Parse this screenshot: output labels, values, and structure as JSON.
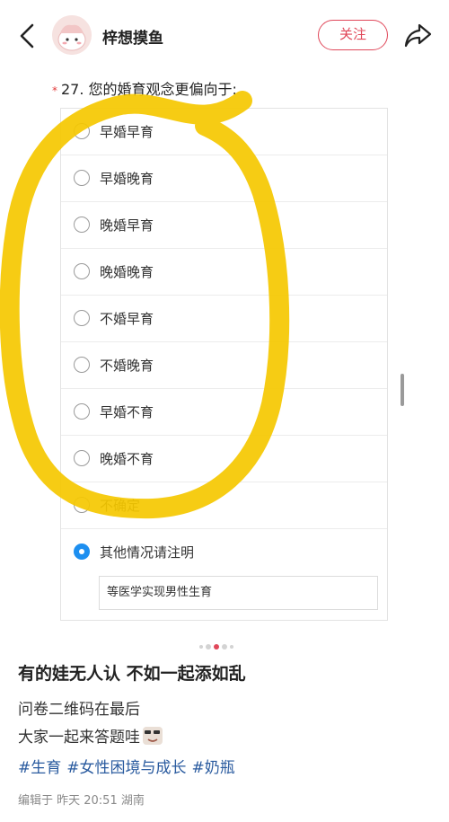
{
  "header": {
    "username": "梓想摸鱼",
    "follow_label": "关注"
  },
  "question": {
    "required_mark": "*",
    "text": "27. 您的婚育观念更偏向于:"
  },
  "options": [
    {
      "label": "早婚早育",
      "selected": false
    },
    {
      "label": "早婚晚育",
      "selected": false
    },
    {
      "label": "晚婚早育",
      "selected": false
    },
    {
      "label": "晚婚晚育",
      "selected": false
    },
    {
      "label": "不婚早育",
      "selected": false
    },
    {
      "label": "不婚晚育",
      "selected": false
    },
    {
      "label": "早婚不育",
      "selected": false
    },
    {
      "label": "晚婚不育",
      "selected": false
    },
    {
      "label": "不确定",
      "selected": false
    },
    {
      "label": "其他情况请注明",
      "selected": true
    }
  ],
  "other_input_value": "等医学实现男性生育",
  "carousel": {
    "count": 5,
    "active_index": 2
  },
  "post": {
    "title": "有的娃无人认  不如一起添如乱",
    "line1": "问卷二维码在最后",
    "line2": "大家一起来答题哇",
    "tags": [
      "#生育",
      "#女性困境与成长",
      "#奶瓶"
    ],
    "meta": "编辑于 昨天 20:51 湖南"
  },
  "colors": {
    "accent": "#e0485a",
    "radio_selected": "#1d8ff0",
    "tag": "#2a5b9f",
    "highlight": "#f5c800"
  }
}
